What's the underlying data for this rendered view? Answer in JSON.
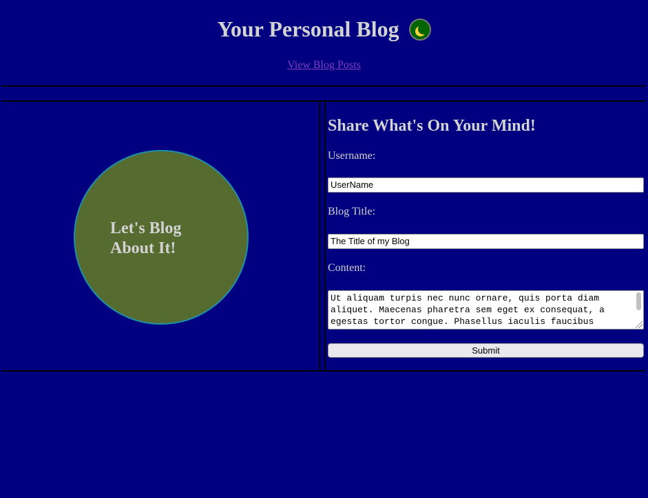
{
  "header": {
    "title": "Your Personal Blog",
    "theme_toggle_icon": "crescent-moon-icon",
    "nav_link": "View Blog Posts"
  },
  "hero": {
    "text_line1": "Let's Blog",
    "text_line2": "About It!"
  },
  "form": {
    "heading": "Share What's On Your Mind!",
    "username_label": "Username:",
    "username_value": "UserName",
    "title_label": "Blog Title:",
    "title_value": "The Title of my Blog",
    "content_label": "Content:",
    "content_value": "Ut aliquam turpis nec nunc ornare, quis porta diam aliquet. Maecenas pharetra sem eget ex consequat, a egestas tortor congue. Phasellus iaculis faucibus",
    "submit_label": "Submit"
  },
  "colors": {
    "background": "#000080",
    "text": "#d3d3d3",
    "link": "#7f3fbf",
    "circle_fill": "#556b2f",
    "circle_border": "#1e90aa",
    "toggle_bg": "#006400"
  }
}
